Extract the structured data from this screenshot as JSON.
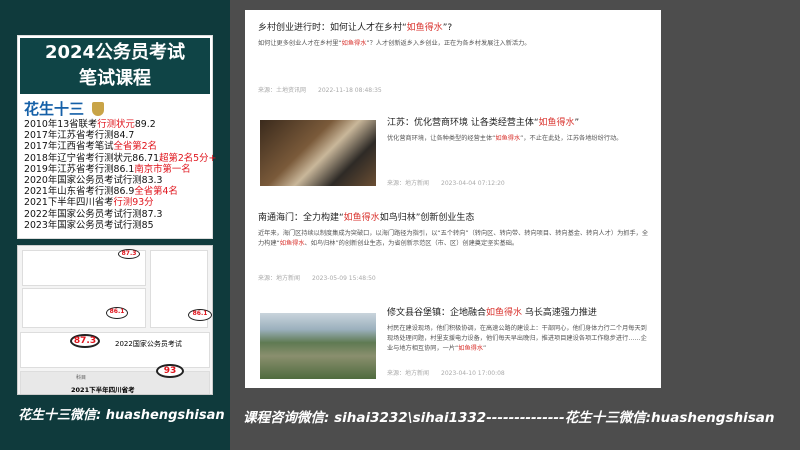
{
  "poster": {
    "title_line1": "2024公务员考试",
    "title_line2": "笔试课程",
    "brand": "花生十三",
    "achievements": [
      {
        "text": "2010年13省联考",
        "hl": "行测状元",
        "tail": "89.2"
      },
      {
        "text": "2017年江苏省考行测84.7",
        "hl": "",
        "tail": ""
      },
      {
        "text": "2017年江西省考笔试",
        "hl": "全省第2名",
        "tail": ""
      },
      {
        "text": "2018年辽宁省考行测状元86.71",
        "hl": "超第2名5分+",
        "tail": ""
      },
      {
        "text": "2019年江苏省考行测86.1",
        "hl": "南京市第一名",
        "tail": ""
      },
      {
        "text": "2020年国家公务员考试行测83.3",
        "hl": "",
        "tail": ""
      },
      {
        "text": "2021年山东省考行测86.9",
        "hl": "全省第4名",
        "tail": ""
      },
      {
        "text": "2021下半年四川省考",
        "hl": "行测93分",
        "tail": ""
      },
      {
        "text": "2022年国家公务员考试行测87.3",
        "hl": "",
        "tail": ""
      },
      {
        "text": "2023年国家公务员考试行测85",
        "hl": "",
        "tail": ""
      }
    ]
  },
  "proof": {
    "score1": "87.3",
    "score2": "86.1",
    "score3": "86.1",
    "score4": "87.3",
    "score5": "93",
    "exam_2022": "2022国家公务员考试",
    "exam_2021": "2021下半年四川省考",
    "col_subject": "科目"
  },
  "left_footer": "花生十三微信: huashengshisan",
  "articles": [
    {
      "title_pre": "乡村创业进行时：如何让人才在乡村“",
      "title_hl": "如鱼得水",
      "title_post": "”?",
      "desc_pre": "如何让更多创业人才在乡村里“",
      "desc_hl": "如鱼得水",
      "desc_post": "”？人才创新返乡入乡创业，正在为各乡村发展注入新活力。",
      "source": "来源：土地资讯网",
      "time": "2022-11-18 08:48:35"
    },
    {
      "title_pre": "江苏：优化营商环境 让各类经营主体“",
      "title_hl": "如鱼得水",
      "title_post": "”",
      "desc_pre": "优化营商环境，让各种类型的经营主体“",
      "desc_hl": "如鱼得水",
      "desc_post": "”，不止在此处，江苏各地纷纷行动。",
      "source": "来源：地方新闻",
      "time": "2023-04-04 07:12:20"
    },
    {
      "title_pre": "南通海门：全力构建“",
      "title_hl": "如鱼得水",
      "title_post": "如鸟归林”创新创业生态",
      "desc_pre": "近年来，海门区持续以制度集成为突破口，以海门路径为指引，以“五个转向”（转向区、转向带、转向项目、转向基金、转向人才）为抓手，全力构建“",
      "desc_hl": "如鱼得水",
      "desc_post": "、如鸟归林”的创新创业生态，为省创新示范区（市、区）创建奠定坚实基础。",
      "source": "来源：地方新闻",
      "time": "2023-05-09 15:48:50"
    },
    {
      "title_pre": "修文县谷堡镇：企地融合",
      "title_hl": "如鱼得水",
      "title_post": " 乌长高速强力推进",
      "desc_pre": "村民在建设现场，他们积极协调，在高速公路的建设上：干部同心，他们身体力行二个月每天到现场处理问题，村里支援电力设备，他们每天早出晚归，推进项目建设各项工作稳步进行……企业与地方相互协同，一片“",
      "desc_hl": "如鱼得水",
      "desc_post": "”",
      "source": "来源：地方新闻",
      "time": "2023-04-10 17:00:08"
    }
  ],
  "bottom_footer": "课程咨询微信: sihai3232\\sihai1332--------------花生十三微信:huashengshisan"
}
